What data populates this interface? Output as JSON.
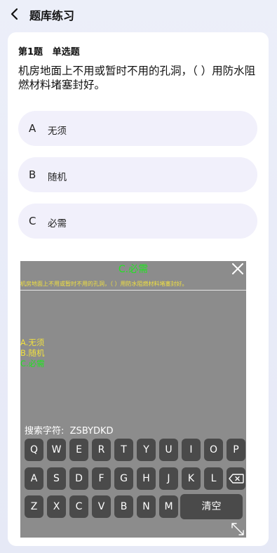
{
  "header": {
    "title": "题库练习"
  },
  "question": {
    "number": "第1题",
    "type": "单选题",
    "text": "机房地面上不用或暂时不用的孔洞，（ ）用防水阻燃材料堵塞封好。"
  },
  "options": [
    {
      "letter": "A",
      "text": "无须"
    },
    {
      "letter": "B",
      "text": "随机"
    },
    {
      "letter": "C",
      "text": "必需"
    }
  ],
  "overlay": {
    "answer": "C.必需",
    "question": "机房地面上不用或暂时不用的孔洞，（ ）用防水阻燃材料堵塞封好。",
    "options": [
      {
        "text": "A.无须",
        "color": "#f1e040"
      },
      {
        "text": "B.随机",
        "color": "#f1e040"
      },
      {
        "text": "C.必需",
        "color": "#22e322"
      }
    ],
    "search_label": "搜索字符:",
    "search_value": "ZSBYDKD",
    "keyboard": {
      "row1": [
        "Q",
        "W",
        "E",
        "R",
        "T",
        "Y",
        "U",
        "I",
        "O",
        "P"
      ],
      "row2": [
        "A",
        "S",
        "D",
        "F",
        "G",
        "H",
        "J",
        "K",
        "L"
      ],
      "row3": [
        "Z",
        "X",
        "C",
        "V",
        "B",
        "N",
        "M"
      ],
      "clear": "清空"
    }
  },
  "colors": {
    "accent_green": "#22e322",
    "accent_yellow": "#f1e040",
    "overlay_bg": "#8c8c8c",
    "key_bg": "#4a4a4a",
    "option_bg": "#f1f0fb"
  }
}
